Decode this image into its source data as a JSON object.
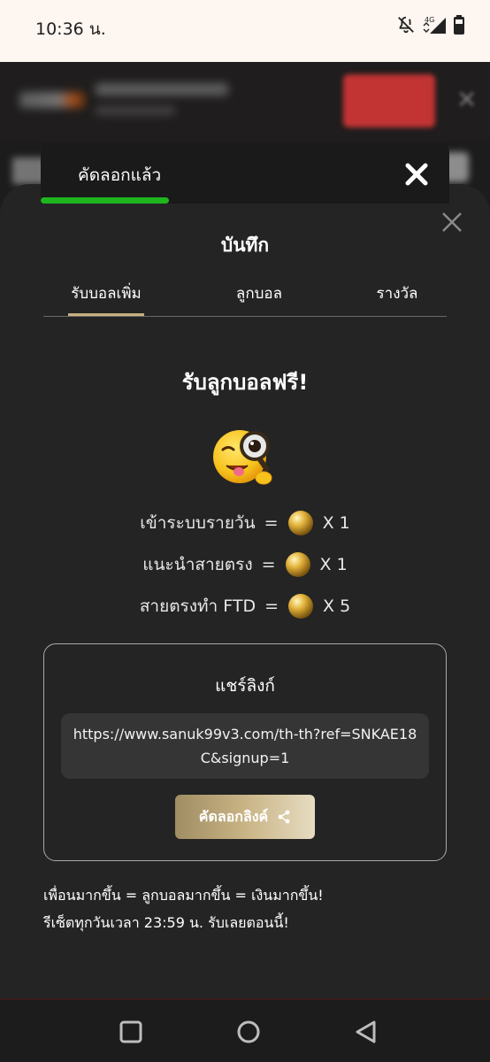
{
  "status_bar": {
    "time": "10:36 น.",
    "network": "4G",
    "icons": [
      "bell-off-icon",
      "signal-icon",
      "battery-icon"
    ]
  },
  "toast": {
    "message": "คัดลอกแล้ว",
    "close_icon": "close-icon",
    "progress_color": "#1fb51f"
  },
  "modal": {
    "title": "บันทึก",
    "close_icon": "close-icon",
    "tabs": [
      {
        "label": "รับบอลเพิ่ม",
        "active": true
      },
      {
        "label": "ลูกบอล",
        "active": false
      },
      {
        "label": "รางวัล",
        "active": false
      }
    ],
    "headline": "รับลูกบอลฟรี!",
    "emoji": "winking-magnifier-emoji",
    "rewards": [
      {
        "label": "เข้าระบบรายวัน",
        "eq": "=",
        "multiplier": "X 1"
      },
      {
        "label": "แนะนำสายตรง",
        "eq": "=",
        "multiplier": "X 1"
      },
      {
        "label": "สายตรงทำ FTD",
        "eq": "=",
        "multiplier": "X 5"
      }
    ],
    "share": {
      "title": "แชร์ลิงก์",
      "link": "https://www.sanuk99v3.com/th-th?ref=SNKAE18C&signup=1",
      "copy_button": "คัดลอกลิงค์",
      "share_icon": "share-icon"
    },
    "footer_line1": "เพื่อนมากขึ้น = ลูกบอลมากขึ้น = เงินมากขึ้น!",
    "footer_line2": "รีเซ็ตทุกวันเวลา 23:59 น. รับเลยตอนนี้!"
  },
  "colors": {
    "accent_gold": "#c8b080",
    "sheet_bg": "#242424",
    "red_button": "#c23434"
  },
  "nav": {
    "items": [
      "recents-icon",
      "home-icon",
      "back-icon"
    ]
  }
}
